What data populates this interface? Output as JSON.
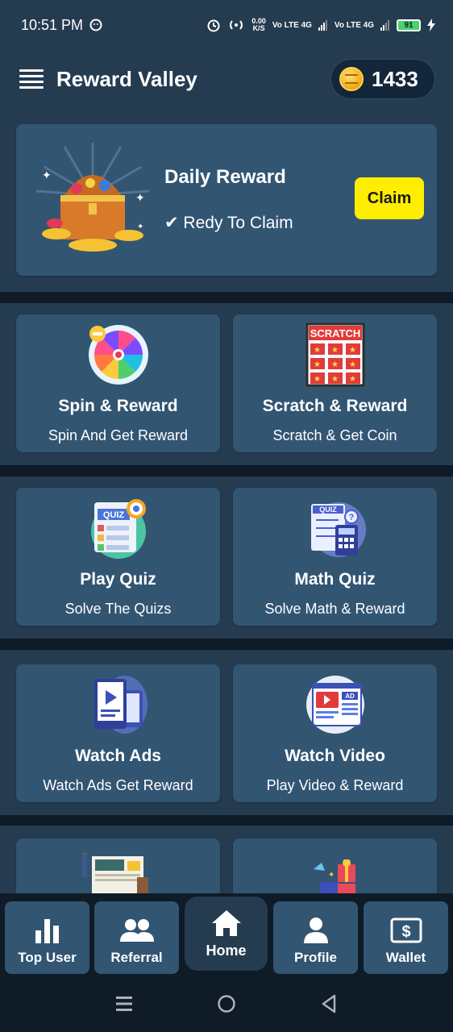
{
  "status_bar": {
    "time": "10:51 PM",
    "speed_value": "0.00",
    "speed_unit": "K/S",
    "network1": "Vo LTE 4G",
    "network2": "Vo LTE 4G",
    "battery": "91"
  },
  "app_bar": {
    "title": "Reward Valley",
    "coins": "1433"
  },
  "daily_reward": {
    "title": "Daily Reward",
    "status": "✔ Redy To Claim",
    "claim_label": "Claim"
  },
  "tiles": [
    {
      "title": "Spin & Reward",
      "subtitle": "Spin And Get Reward",
      "icon": "spin-wheel-icon"
    },
    {
      "title": "Scratch & Reward",
      "subtitle": "Scratch & Get Coin",
      "icon": "scratch-card-icon",
      "badge": "SCRATCH"
    },
    {
      "title": "Play Quiz",
      "subtitle": "Solve The Quizs",
      "icon": "quiz-icon",
      "badge": "QUIZ"
    },
    {
      "title": "Math Quiz",
      "subtitle": "Solve Math & Reward",
      "icon": "math-quiz-icon",
      "badge": "QUIZ"
    },
    {
      "title": "Watch Ads",
      "subtitle": "Watch Ads Get Reward",
      "icon": "watch-ads-icon"
    },
    {
      "title": "Watch Video",
      "subtitle": "Play Video & Reward",
      "icon": "watch-video-icon",
      "badge": "AD"
    }
  ],
  "bottom_nav": [
    {
      "label": "Top User",
      "icon": "bar-chart-icon"
    },
    {
      "label": "Referral",
      "icon": "people-icon"
    },
    {
      "label": "Home",
      "icon": "home-icon",
      "active": true
    },
    {
      "label": "Profile",
      "icon": "person-icon"
    },
    {
      "label": "Wallet",
      "icon": "wallet-icon"
    }
  ],
  "colors": {
    "background": "#0f1b27",
    "band": "#253b50",
    "card": "#325572",
    "claim": "#ffee00",
    "battery": "#46d36b"
  }
}
